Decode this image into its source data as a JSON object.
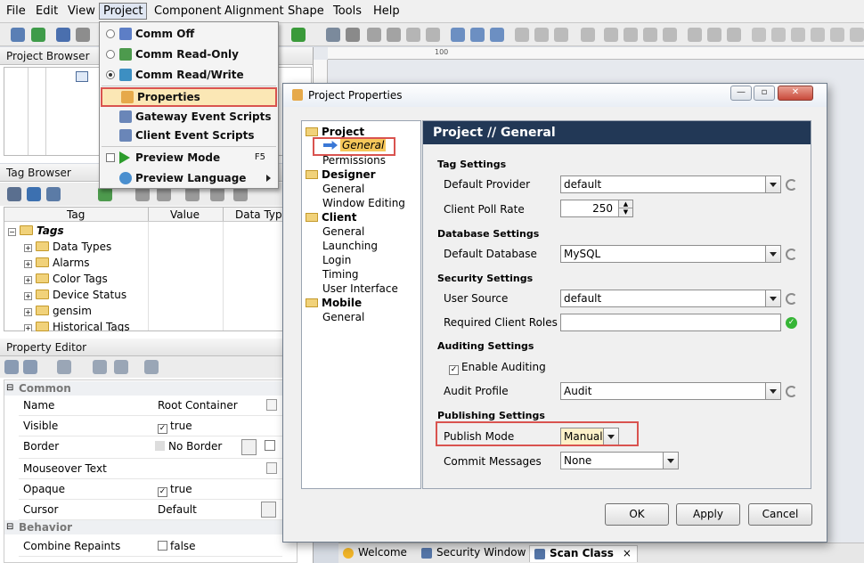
{
  "menubar": {
    "items": [
      "File",
      "Edit",
      "View",
      "Project",
      "Component",
      "Alignment",
      "Shape",
      "Tools",
      "Help"
    ]
  },
  "project_browser": {
    "title": "Project Browser"
  },
  "tag_browser": {
    "title": "Tag Browser",
    "columns": [
      "Tag",
      "Value",
      "Data Type"
    ],
    "root": "Tags",
    "items": [
      "Data Types",
      "Alarms",
      "Color Tags",
      "Device Status",
      "gensim",
      "Historical Tags"
    ]
  },
  "property_editor": {
    "title": "Property Editor",
    "sections": {
      "common": "Common",
      "behavior": "Behavior"
    },
    "rows": [
      {
        "name": "Name",
        "value": "Root Container"
      },
      {
        "name": "Visible",
        "value": "true"
      },
      {
        "name": "Border",
        "value": "No Border"
      },
      {
        "name": "Mouseover Text",
        "value": ""
      },
      {
        "name": "Opaque",
        "value": "true"
      },
      {
        "name": "Cursor",
        "value": "Default"
      }
    ],
    "behavior_rows": [
      {
        "name": "Combine Repaints",
        "value": "false"
      }
    ]
  },
  "project_menu": {
    "items": [
      {
        "label": "Comm Off",
        "kind": "radio",
        "checked": false
      },
      {
        "label": "Comm Read-Only",
        "kind": "radio",
        "checked": false
      },
      {
        "label": "Comm Read/Write",
        "kind": "radio",
        "checked": true
      },
      {
        "label": "Properties",
        "kind": "item",
        "highlighted": true
      },
      {
        "label": "Gateway Event Scripts",
        "kind": "item"
      },
      {
        "label": "Client Event Scripts",
        "kind": "item"
      },
      {
        "label": "Preview Mode",
        "kind": "check",
        "shortcut": "F5"
      },
      {
        "label": "Preview Language",
        "kind": "submenu"
      }
    ]
  },
  "dialog": {
    "title": "Project Properties",
    "header": "Project // General",
    "nav": {
      "groups": [
        {
          "label": "Project",
          "children": [
            "General",
            "Permissions"
          ]
        },
        {
          "label": "Designer",
          "children": [
            "General",
            "Window Editing"
          ]
        },
        {
          "label": "Client",
          "children": [
            "General",
            "Launching",
            "Login",
            "Timing",
            "User Interface"
          ]
        },
        {
          "label": "Mobile",
          "children": [
            "General"
          ]
        }
      ],
      "selected": "General"
    },
    "sections": {
      "tag_settings": "Tag Settings",
      "database_settings": "Database Settings",
      "security_settings": "Security Settings",
      "auditing_settings": "Auditing Settings",
      "publishing_settings": "Publishing Settings"
    },
    "fields": {
      "default_provider": {
        "label": "Default Provider",
        "value": "default"
      },
      "client_poll_rate": {
        "label": "Client Poll Rate",
        "value": "250"
      },
      "default_database": {
        "label": "Default Database",
        "value": "MySQL"
      },
      "user_source": {
        "label": "User Source",
        "value": "default"
      },
      "required_client_roles": {
        "label": "Required Client Roles",
        "value": ""
      },
      "enable_auditing": {
        "label": "Enable Auditing",
        "checked": true
      },
      "audit_profile": {
        "label": "Audit Profile",
        "value": "Audit"
      },
      "publish_mode": {
        "label": "Publish Mode",
        "value": "Manual"
      },
      "commit_messages": {
        "label": "Commit Messages",
        "value": "None"
      }
    },
    "buttons": {
      "ok": "OK",
      "apply": "Apply",
      "cancel": "Cancel"
    }
  },
  "bottom_tabs": [
    "Welcome",
    "Security Window",
    "Scan Class"
  ],
  "ruler": {
    "mark": "100"
  },
  "colors": {
    "highlight_red": "#d9534f",
    "header_navy": "#223856",
    "menu_highlight": "#fbe7b5"
  }
}
